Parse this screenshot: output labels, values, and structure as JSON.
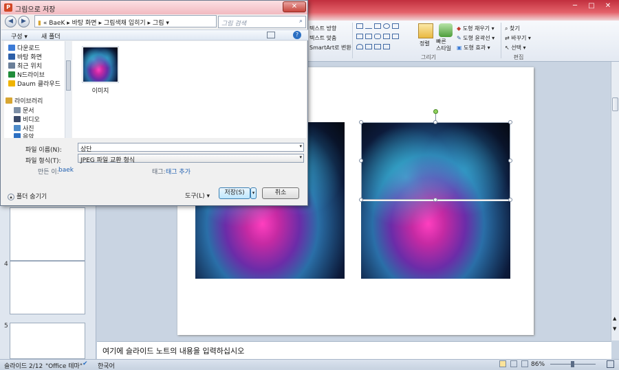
{
  "ribbon": {
    "partial_left": [
      "텍스트 방향",
      "텍스트 맞춤",
      "SmartArt로 변환"
    ],
    "arrange_label": "정렬",
    "quick_style_label": "빠른\n스타일",
    "shape_fill": "도형 채우기",
    "shape_outline": "도형 윤곽선",
    "shape_effects": "도형 효과",
    "drawing_group": "그리기",
    "find": "찾기",
    "replace": "바꾸기",
    "select": "선택",
    "editing_group": "편집"
  },
  "slides_panel": {
    "numbers": [
      "4",
      "5"
    ]
  },
  "notes": {
    "placeholder": "여기에 슬라이드 노트의 내용을 입력하십시오"
  },
  "status": {
    "slide_info": "슬라이드 2/12",
    "theme": "\"Office 테마\"",
    "language": "한국어",
    "zoom": "86%"
  },
  "dialog": {
    "title": "그림으로 저장",
    "address": {
      "prefix": "«",
      "segments": [
        "BaeK",
        "바탕 화면",
        "그림색채 입히기",
        "그림"
      ]
    },
    "search_placeholder": "그림 검색",
    "toolbar": {
      "organize": "구성 ▾",
      "new_folder": "새 폴더"
    },
    "nav_items": [
      {
        "label": "다운로드",
        "icon": "download-folder-icon",
        "color": "#3c7bd6"
      },
      {
        "label": "바탕 화면",
        "icon": "desktop-icon",
        "color": "#2d5fa8"
      },
      {
        "label": "최근 위치",
        "icon": "recent-places-icon",
        "color": "#6b7f99"
      },
      {
        "label": "N드라이브",
        "icon": "ndrive-icon",
        "color": "#1f8c3a"
      },
      {
        "label": "Daum 클라우드",
        "icon": "daum-cloud-icon",
        "color": "#f0b400"
      }
    ],
    "library_header": "라이브러리",
    "library_items": [
      {
        "label": "문서",
        "icon": "documents-icon",
        "color": "#7d8fa6"
      },
      {
        "label": "비디오",
        "icon": "videos-icon",
        "color": "#3b4a6a"
      },
      {
        "label": "사진",
        "icon": "pictures-icon",
        "color": "#4e8bc9"
      },
      {
        "label": "음악",
        "icon": "music-icon",
        "color": "#2b6fc2"
      }
    ],
    "file": {
      "name": "이미지"
    },
    "filename_label": "파일 이름(N):",
    "filename_value": "상단",
    "filetype_label": "파일 형식(T):",
    "filetype_value": "JPEG 파일 교환 형식",
    "author_label": "만든 이:",
    "author_value": "baek",
    "tags_label": "태그:",
    "tags_value": "태그 추가",
    "hide_folders": "폴더 숨기기",
    "tools": "도구(L)",
    "save": "저장(S)",
    "cancel": "취소"
  }
}
